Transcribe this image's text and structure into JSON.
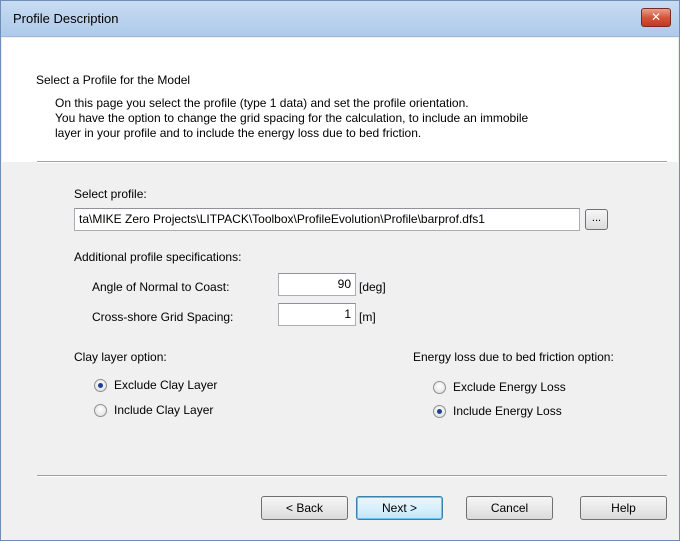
{
  "window": {
    "title": "Profile Description",
    "close_glyph": "✕"
  },
  "header": {
    "heading": "Select a Profile for the Model",
    "description_lines": [
      "On this page you select the profile (type 1 data) and set the profile orientation.",
      "You have the option to change the grid spacing for the calculation, to include an immobile",
      "layer in your profile and to include the energy loss due to bed friction."
    ]
  },
  "profile": {
    "label": "Select profile:",
    "path_value": "ta\\MIKE Zero Projects\\LITPACK\\Toolbox\\ProfileEvolution\\Profile\\barprof.dfs1",
    "browse_label": "..."
  },
  "specs": {
    "heading": "Additional profile specifications:",
    "angle": {
      "label": "Angle of Normal to Coast:",
      "value": "90",
      "unit": "[deg]"
    },
    "grid": {
      "label": "Cross-shore Grid Spacing:",
      "value": "1",
      "unit": "[m]"
    }
  },
  "clay": {
    "heading": "Clay layer option:",
    "options": [
      {
        "label": "Exclude Clay Layer",
        "selected": true
      },
      {
        "label": "Include Clay Layer",
        "selected": false
      }
    ]
  },
  "energy": {
    "heading": "Energy loss due to bed friction option:",
    "options": [
      {
        "label": "Exclude Energy Loss",
        "selected": false
      },
      {
        "label": "Include Energy Loss",
        "selected": true
      }
    ]
  },
  "buttons": {
    "back": "< Back",
    "next": "Next >",
    "cancel": "Cancel",
    "help": "Help"
  }
}
